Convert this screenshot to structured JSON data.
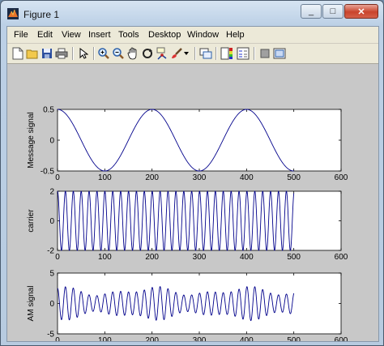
{
  "window": {
    "title": "Figure 1"
  },
  "window_buttons": {
    "minimize": "_",
    "maximize": "□",
    "close": "✕"
  },
  "menu": [
    "File",
    "Edit",
    "View",
    "Insert",
    "Tools",
    "Desktop",
    "Window",
    "Help"
  ],
  "toolbar_icons": [
    "new-figure-icon",
    "open-file-icon",
    "save-icon",
    "print-icon",
    "pointer-icon",
    "zoom-in-icon",
    "zoom-out-icon",
    "pan-icon",
    "rotate-icon",
    "data-cursor-icon",
    "brush-icon",
    "brush-dropdown-icon",
    "link-plot-icon",
    "colorbar-icon",
    "legend-icon",
    "hide-plot-tools-icon",
    "show-plot-tools-icon"
  ],
  "colors": {
    "line": "#00008b",
    "axes_bg": "#ffffff",
    "figure_bg": "#c8c8c8"
  },
  "chart_data": [
    {
      "type": "line",
      "title": "",
      "xlabel": "",
      "ylabel": "Message signal",
      "xlim": [
        0,
        600
      ],
      "ylim": [
        -0.5,
        0.5
      ],
      "xticks": [
        "0",
        "100",
        "200",
        "300",
        "400",
        "500",
        "600"
      ],
      "yticks": [
        "-0.5",
        "0",
        "0.5"
      ],
      "grid": false,
      "series": [
        {
          "function": "0.5*cos(2*pi*t/200)",
          "x_range": [
            0,
            500
          ],
          "samples": 501
        }
      ]
    },
    {
      "type": "line",
      "title": "",
      "xlabel": "",
      "ylabel": "carrier",
      "xlim": [
        0,
        600
      ],
      "ylim": [
        -2,
        2
      ],
      "xticks": [
        "0",
        "100",
        "200",
        "300",
        "400",
        "500",
        "600"
      ],
      "yticks": [
        "-2",
        "0",
        "2"
      ],
      "grid": false,
      "series": [
        {
          "function": "2*cos(2*pi*t/16.7)",
          "x_range": [
            0,
            500
          ],
          "cycles": 30
        }
      ]
    },
    {
      "type": "line",
      "title": "",
      "xlabel": "",
      "ylabel": "AM signal",
      "xlim": [
        0,
        600
      ],
      "ylim": [
        -5,
        5
      ],
      "xticks": [
        "0",
        "100",
        "200",
        "300",
        "400",
        "500",
        "600"
      ],
      "yticks": [
        "-5",
        "0",
        "5"
      ],
      "grid": false,
      "series": [
        {
          "function": "(2+0.5*cos(2*pi*t/200))*cos(2*pi*t/16.7) approx",
          "x_range": [
            0,
            500
          ],
          "peak_amplitude": 3
        }
      ]
    }
  ]
}
